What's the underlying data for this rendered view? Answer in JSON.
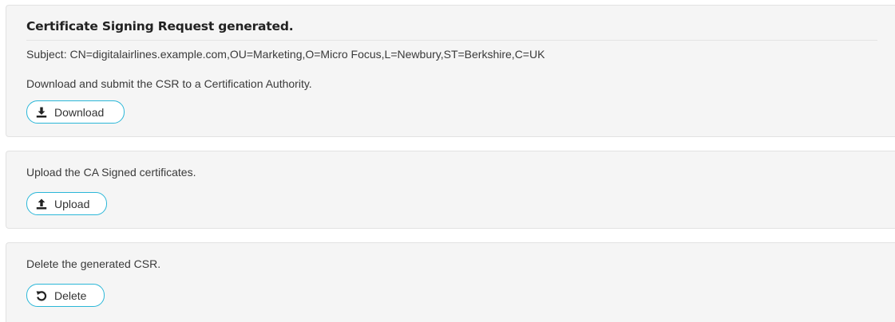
{
  "csr_panel": {
    "title": "Certificate Signing Request generated.",
    "subject": "Subject: CN=digitalairlines.example.com,OU=Marketing,O=Micro Focus,L=Newbury,ST=Berkshire,C=UK",
    "description": "Download and submit the CSR to a Certification Authority.",
    "download_button": {
      "label": "Download",
      "icon": "download-icon"
    }
  },
  "upload_panel": {
    "description": "Upload the CA Signed certificates.",
    "upload_button": {
      "label": "Upload",
      "icon": "upload-icon"
    }
  },
  "delete_panel": {
    "description": "Delete the generated CSR.",
    "delete_button": {
      "label": "Delete",
      "icon": "undo-icon"
    }
  },
  "colors": {
    "panel_bg": "#f5f5f5",
    "button_border": "#2bb7d8"
  }
}
